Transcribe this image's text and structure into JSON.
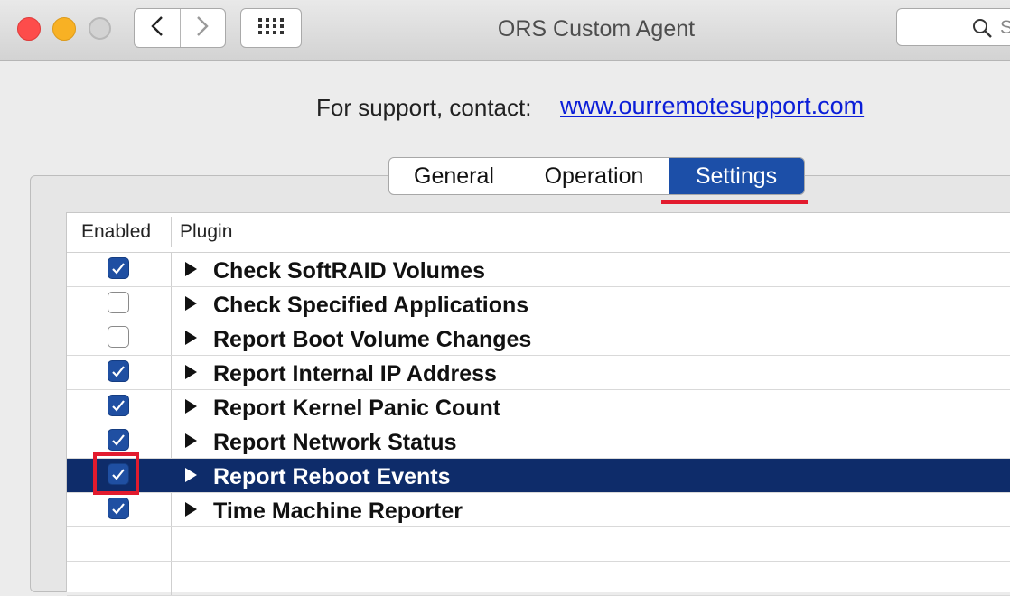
{
  "window": {
    "title": "ORS Custom Agent",
    "search_placeholder": "S"
  },
  "support": {
    "text": "For support, contact:",
    "link": "www.ourremotesupport.com"
  },
  "tabs": [
    {
      "label": "General",
      "selected": false
    },
    {
      "label": "Operation",
      "selected": false
    },
    {
      "label": "Settings",
      "selected": true
    }
  ],
  "table": {
    "headers": {
      "enabled": "Enabled",
      "plugin": "Plugin"
    },
    "rows": [
      {
        "name": "Check SoftRAID Volumes",
        "enabled": true,
        "selected": false
      },
      {
        "name": "Check Specified Applications",
        "enabled": false,
        "selected": false
      },
      {
        "name": "Report Boot Volume Changes",
        "enabled": false,
        "selected": false
      },
      {
        "name": "Report Internal IP Address",
        "enabled": true,
        "selected": false
      },
      {
        "name": "Report Kernel Panic Count",
        "enabled": true,
        "selected": false
      },
      {
        "name": "Report Network Status",
        "enabled": true,
        "selected": false
      },
      {
        "name": "Report Reboot Events",
        "enabled": true,
        "selected": true
      },
      {
        "name": "Time Machine Reporter",
        "enabled": true,
        "selected": false
      }
    ]
  },
  "colors": {
    "accent": "#1c4fa8",
    "selected_row": "#0e2c6a",
    "highlight": "#e21b2e"
  },
  "icons": [
    "back-arrow-icon",
    "forward-arrow-icon",
    "grid-icon",
    "search-icon",
    "disclosure-triangle-icon",
    "checkmark-icon"
  ]
}
